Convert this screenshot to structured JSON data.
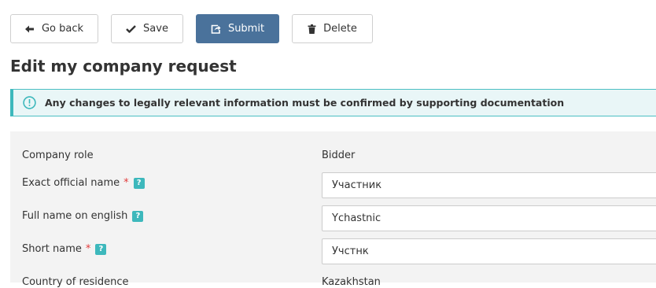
{
  "toolbar": {
    "back_label": "Go back",
    "save_label": "Save",
    "submit_label": "Submit",
    "delete_label": "Delete"
  },
  "page": {
    "title": "Edit my company request"
  },
  "notice": {
    "message": "Any changes to legally relevant information must be confirmed by supporting documentation"
  },
  "form": {
    "company_role": {
      "label": "Company role",
      "value": "Bidder"
    },
    "exact_official_name": {
      "label": "Exact official name",
      "required_mark": "*",
      "help": "?",
      "value": "Участник"
    },
    "full_name_english": {
      "label": "Full name on english",
      "help": "?",
      "value": "Ychastnic"
    },
    "short_name": {
      "label": "Short name",
      "required_mark": "*",
      "help": "?",
      "value": "Учстнк"
    },
    "country_of_residence": {
      "label": "Country of residence",
      "value": "Kazakhstan"
    }
  },
  "colors": {
    "primary": "#4a729b",
    "info_accent": "#3db8bc",
    "info_background": "#e9f6f7",
    "required": "#e23c3c",
    "form_background": "#f3f3f3"
  }
}
